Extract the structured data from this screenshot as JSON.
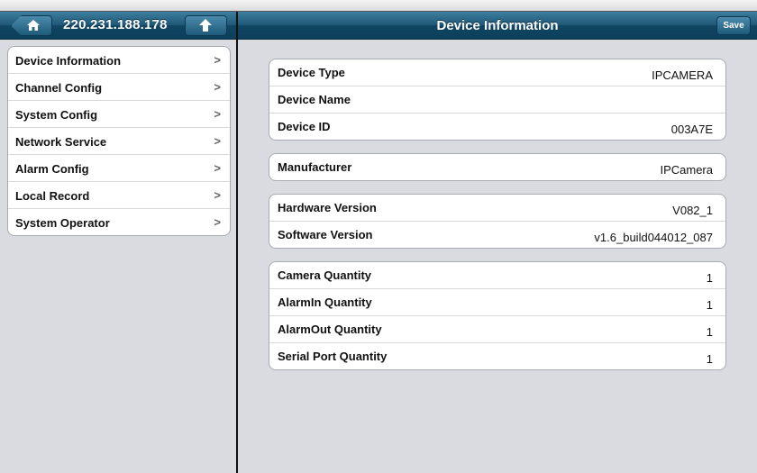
{
  "left_header": {
    "ip": "220.231.188.178",
    "home_icon": "home-icon",
    "up_icon": "up-arrow-icon"
  },
  "menu": {
    "items": [
      {
        "label": "Device Information"
      },
      {
        "label": "Channel Config"
      },
      {
        "label": "System Config"
      },
      {
        "label": "Network Service"
      },
      {
        "label": "Alarm Config"
      },
      {
        "label": "Local Record"
      },
      {
        "label": "System Operator"
      }
    ],
    "chevron": ">"
  },
  "right_header": {
    "title": "Device Information",
    "save_label": "Save"
  },
  "groups": {
    "identity": [
      {
        "key": "Device Type",
        "value": "IPCAMERA"
      },
      {
        "key": "Device Name",
        "value": ""
      },
      {
        "key": "Device ID",
        "value": "003A7E"
      }
    ],
    "maker": [
      {
        "key": "Manufacturer",
        "value": "IPCamera"
      }
    ],
    "versions": [
      {
        "key": "Hardware Version",
        "value": "V082_1"
      },
      {
        "key": "Software Version",
        "value": "v1.6_build044012_087"
      }
    ],
    "quantities": [
      {
        "key": "Camera Quantity",
        "value": "1"
      },
      {
        "key": "AlarmIn Quantity",
        "value": "1"
      },
      {
        "key": "AlarmOut Quantity",
        "value": "1"
      },
      {
        "key": "Serial Port Quantity",
        "value": "1"
      }
    ]
  },
  "colors": {
    "navbar": "#1f5877",
    "background": "#d9dbe0"
  }
}
